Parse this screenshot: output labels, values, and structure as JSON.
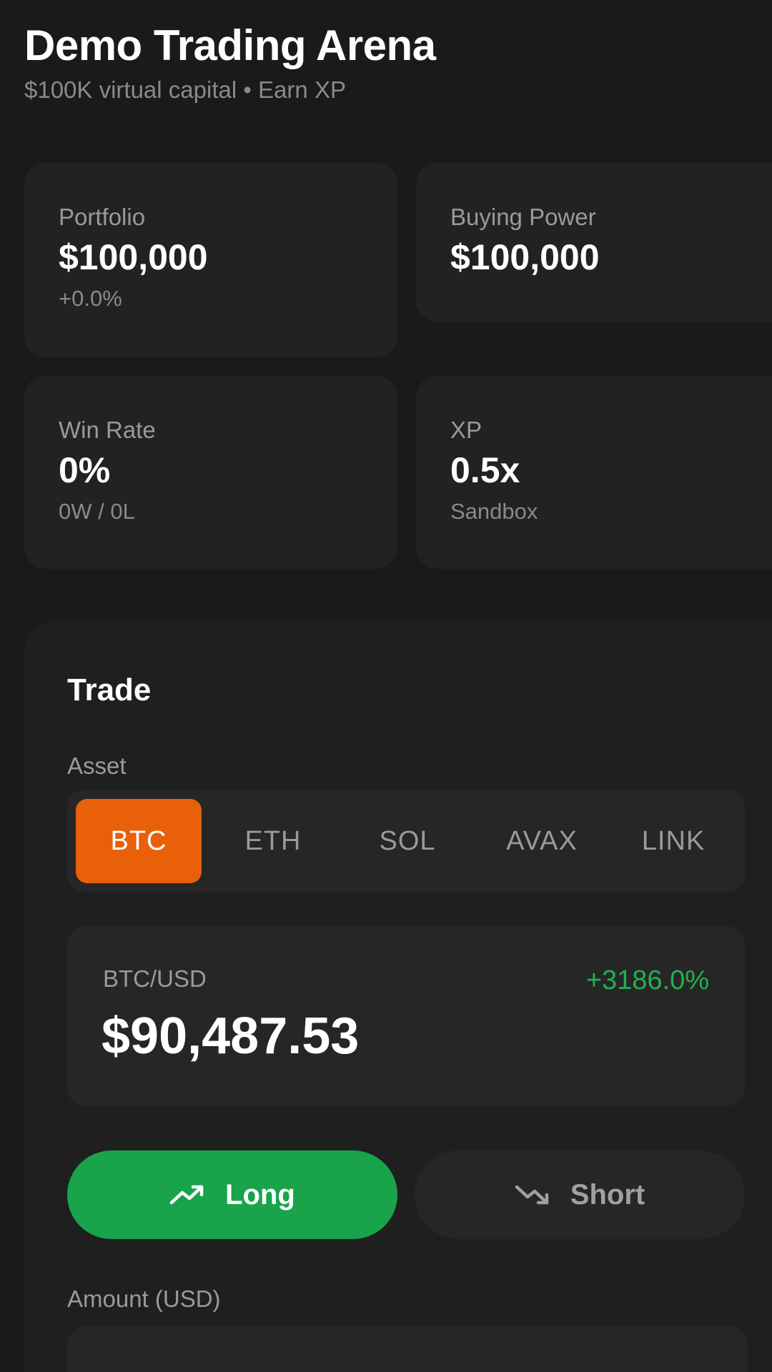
{
  "header": {
    "title": "Demo Trading Arena",
    "subtitle": "$100K virtual capital • Earn XP"
  },
  "stats": {
    "portfolio": {
      "label": "Portfolio",
      "value": "$100,000",
      "sub": "+0.0%"
    },
    "buying_power": {
      "label": "Buying Power",
      "value": "$100,000"
    },
    "win_rate": {
      "label": "Win Rate",
      "value": "0%",
      "sub": "0W / 0L"
    },
    "xp": {
      "label": "XP",
      "value": "0.5x",
      "sub": "Sandbox"
    }
  },
  "trade": {
    "title": "Trade",
    "asset_label": "Asset",
    "assets": [
      "BTC",
      "ETH",
      "SOL",
      "AVAX",
      "LINK"
    ],
    "selected_asset": "BTC",
    "pair": "BTC/USD",
    "change": "+3186.0%",
    "price": "$90,487.53",
    "long_label": "Long",
    "short_label": "Short",
    "amount_label": "Amount (USD)"
  },
  "colors": {
    "background": "#1a1a1a",
    "card": "#222222",
    "accent_orange": "#e8600a",
    "long_green": "#19a34b",
    "positive_text": "#22b04f"
  },
  "icons": {
    "long": "trending-up-icon",
    "short": "trending-down-icon"
  }
}
